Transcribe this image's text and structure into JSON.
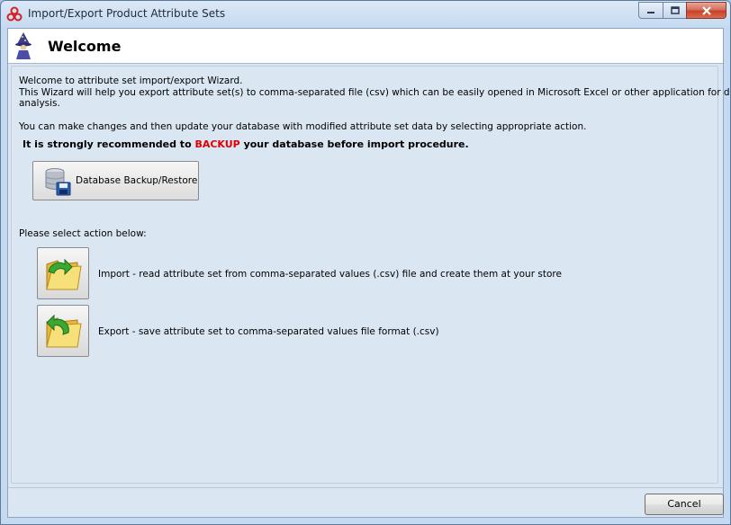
{
  "window": {
    "title": "Import/Export Product Attribute Sets",
    "app_icon": "triple-ring-logo-icon",
    "buttons": [
      "minimize",
      "maximize",
      "close"
    ]
  },
  "header": {
    "title": "Welcome",
    "icon": "wizard-icon"
  },
  "intro": {
    "line1": "Welcome to attribute set import/export Wizard.",
    "line2": "This Wizard will help you export attribute set(s) to comma-separated file (csv) which can be easily opened in Microsoft Excel or other application for detailed",
    "line3": "analysis.",
    "line4": "You can make changes and then update your database with modified attribute set data by selecting appropriate action."
  },
  "warning": {
    "prefix": "It is strongly recommended to ",
    "highlight": "BACKUP",
    "suffix": " your database before import procedure."
  },
  "backup_button": {
    "label": "Database Backup/Restore",
    "icon": "database-save-icon"
  },
  "select_prompt": "Please select action below:",
  "actions": [
    {
      "label": "Import - read attribute set from comma-separated values (.csv) file and create them at your store",
      "icon": "folder-import-icon"
    },
    {
      "label": "Export - save attribute set to comma-separated values file format (.csv)",
      "icon": "folder-export-icon"
    }
  ],
  "footer": {
    "cancel_label": "Cancel"
  },
  "colors": {
    "warning_highlight": "#e00000",
    "client_bg": "#dbe6f3",
    "frame_bg": "#c5daf1"
  }
}
